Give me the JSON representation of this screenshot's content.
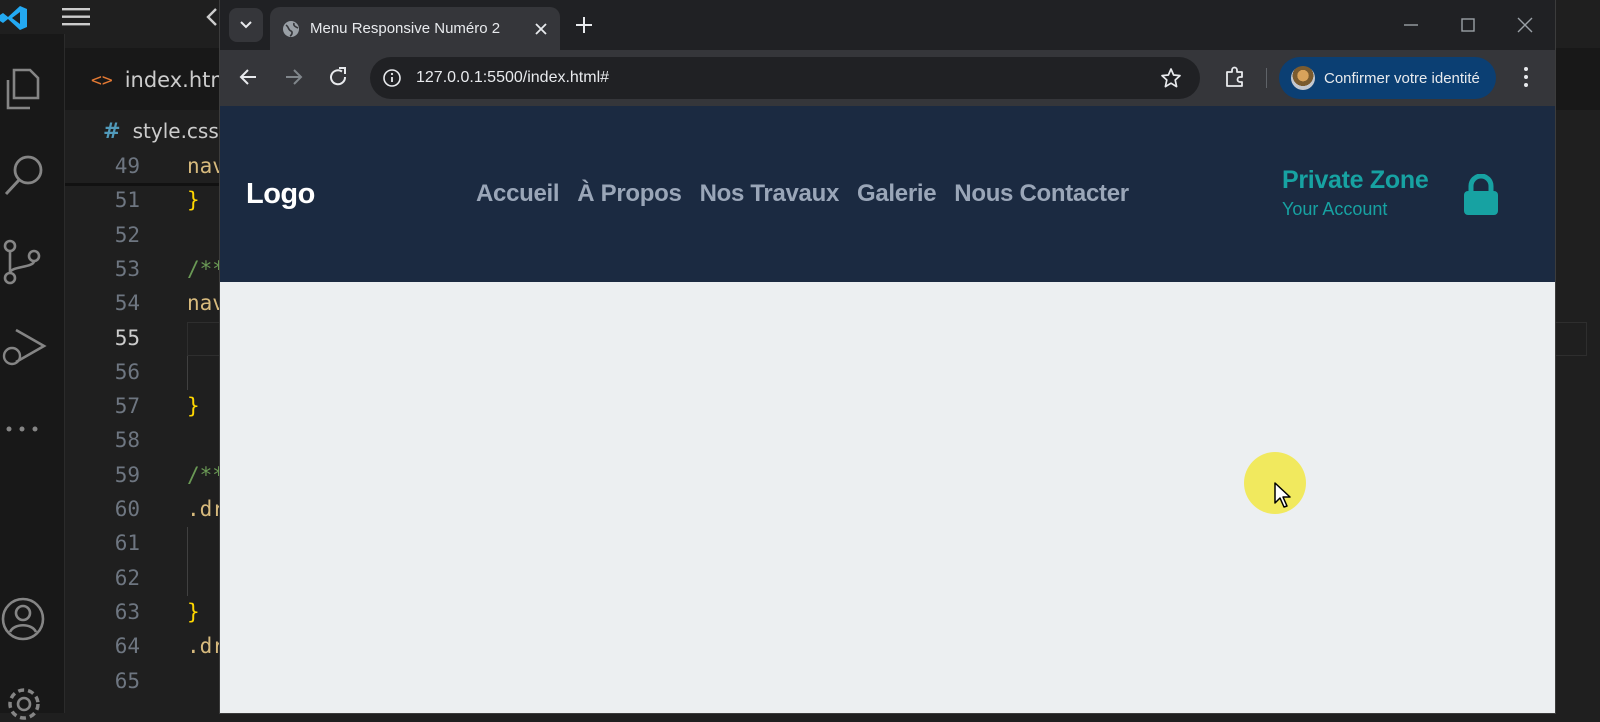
{
  "vscode": {
    "tab_file": "index.htm",
    "tab_icon_glyph": "<>",
    "breadcrumb_hash": "#",
    "breadcrumb_file": "style.css",
    "lines": [
      {
        "num": "49",
        "text": "nav",
        "style": "kw",
        "current": false
      },
      {
        "num": "51",
        "text": "}",
        "style": "br",
        "current": false
      },
      {
        "num": "52",
        "text": "",
        "style": "",
        "current": false
      },
      {
        "num": "53",
        "text": "/**",
        "style": "cm",
        "current": false
      },
      {
        "num": "54",
        "text": "nav",
        "style": "kw",
        "current": false
      },
      {
        "num": "55",
        "text": "",
        "style": "",
        "current": true
      },
      {
        "num": "56",
        "text": "",
        "style": "",
        "current": false
      },
      {
        "num": "57",
        "text": "}",
        "style": "br",
        "current": false
      },
      {
        "num": "58",
        "text": "",
        "style": "",
        "current": false
      },
      {
        "num": "59",
        "text": "/**",
        "style": "cm",
        "current": false
      },
      {
        "num": "60",
        "text": ".dr",
        "style": "kw",
        "current": false
      },
      {
        "num": "61",
        "text": "",
        "style": "",
        "current": false
      },
      {
        "num": "62",
        "text": "",
        "style": "",
        "current": false
      },
      {
        "num": "63",
        "text": "}",
        "style": "br",
        "current": false
      },
      {
        "num": "64",
        "text": ".dr",
        "style": "kw",
        "current": false
      },
      {
        "num": "65",
        "text": "",
        "style": "",
        "current": false
      }
    ]
  },
  "chrome": {
    "tab_title": "Menu Responsive Numéro 2",
    "url": "127.0.0.1:5500/index.html#",
    "identity_label": "Confirmer votre identité"
  },
  "site": {
    "logo": "Logo",
    "nav": [
      "Accueil",
      "À Propos",
      "Nos Travaux",
      "Galerie",
      "Nous Contacter"
    ],
    "private_title": "Private Zone",
    "private_subtitle": "Your Account"
  },
  "colors": {
    "navbar_bg": "#1b2a41",
    "accent_teal": "#17a2a2",
    "nav_link": "#9aa6b8",
    "page_bg": "#eceff1",
    "cursor_highlight": "#f2e84e"
  },
  "icons": {
    "vscode_activity": [
      "explorer-icon",
      "search-icon",
      "source-control-icon",
      "run-debug-icon",
      "more-icon",
      "account-icon",
      "settings-icon"
    ],
    "site_private": "lock-icon"
  }
}
